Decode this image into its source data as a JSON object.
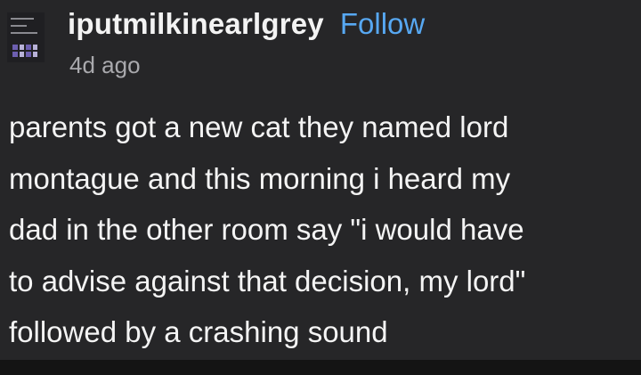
{
  "post": {
    "username": "iputmilkinearlgrey",
    "follow_label": "Follow",
    "timestamp": "4d ago",
    "avatar_icon": "avatar-image",
    "body_lines": [
      "parents got a new cat they named lord",
      "montague and this morning i heard my",
      "dad in the other room say \"i would have",
      "to advise against that decision, my lord\"",
      "followed by a crashing sound"
    ]
  },
  "colors": {
    "background": "#262628",
    "text": "#f4f4f4",
    "follow_link": "#57a8f2",
    "timestamp": "#a9a9ad"
  }
}
